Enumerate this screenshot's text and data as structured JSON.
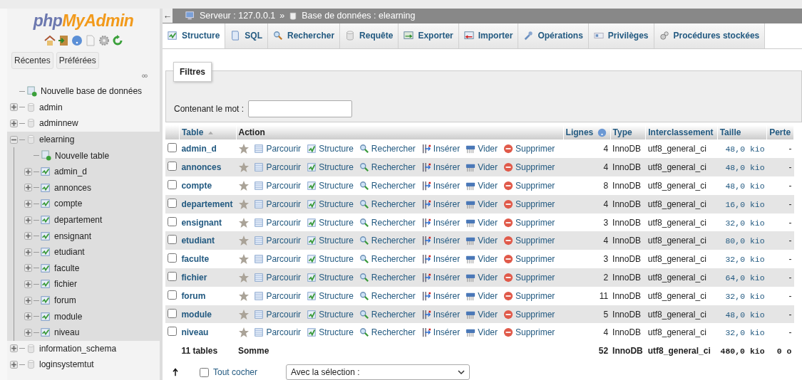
{
  "sidebar": {
    "logo_parts": [
      "php",
      "MyAdmin"
    ],
    "buttons": [
      "Récentes",
      "Préférées"
    ],
    "tree": [
      {
        "label": "Nouvelle base de données",
        "kind": "new",
        "selected": false
      },
      {
        "label": "admin",
        "kind": "database",
        "expanded": false,
        "selected": false
      },
      {
        "label": "adminnew",
        "kind": "database",
        "expanded": false,
        "selected": false
      },
      {
        "label": "elearning",
        "kind": "database",
        "expanded": true,
        "selected": true,
        "children": [
          {
            "label": "Nouvelle table",
            "kind": "new"
          },
          {
            "label": "admin_d",
            "kind": "table"
          },
          {
            "label": "annonces",
            "kind": "table"
          },
          {
            "label": "compte",
            "kind": "table"
          },
          {
            "label": "departement",
            "kind": "table"
          },
          {
            "label": "ensignant",
            "kind": "table"
          },
          {
            "label": "etudiant",
            "kind": "table"
          },
          {
            "label": "faculte",
            "kind": "table"
          },
          {
            "label": "fichier",
            "kind": "table"
          },
          {
            "label": "forum",
            "kind": "table"
          },
          {
            "label": "module",
            "kind": "table"
          },
          {
            "label": "niveau",
            "kind": "table"
          }
        ]
      },
      {
        "label": "information_schema",
        "kind": "database",
        "expanded": false,
        "selected": false
      },
      {
        "label": "loginsystemtut",
        "kind": "database",
        "expanded": false,
        "selected": false
      }
    ]
  },
  "breadcrumb": {
    "back": "←",
    "server": "Serveur : 127.0.0.1",
    "separator": "»",
    "database": "Base de données : elearning"
  },
  "tabs": [
    {
      "label": "Structure",
      "kind": "structure",
      "selected": true
    },
    {
      "label": "SQL",
      "kind": "sql",
      "selected": false
    },
    {
      "label": "Rechercher",
      "kind": "search",
      "selected": false
    },
    {
      "label": "Requête",
      "kind": "query",
      "selected": false
    },
    {
      "label": "Exporter",
      "kind": "export",
      "selected": false
    },
    {
      "label": "Importer",
      "kind": "import",
      "selected": false
    },
    {
      "label": "Opérations",
      "kind": "operations",
      "selected": false
    },
    {
      "label": "Privilèges",
      "kind": "privileges",
      "selected": false
    },
    {
      "label": "Procédures stockées",
      "kind": "procedures",
      "selected": false
    }
  ],
  "filter": {
    "legend": "Filtres",
    "label": "Contenant le mot :"
  },
  "table": {
    "columns": [
      {
        "label": "Table"
      },
      {
        "label": "Action"
      },
      {
        "label": "Lignes"
      },
      {
        "label": "Type"
      },
      {
        "label": "Interclassement"
      },
      {
        "label": "Taille"
      },
      {
        "label": "Perte"
      }
    ],
    "rows": [
      {
        "name": "admin_d",
        "checked": false,
        "favorite": false,
        "actions": [
          "Parcourir",
          "Structure",
          "Rechercher",
          "Insérer",
          "Vider",
          "Supprimer"
        ],
        "rows": "4",
        "type": "InnoDB",
        "collation": "utf8_general_ci",
        "size": "48,0 kio",
        "overhead": "-"
      },
      {
        "name": "annonces",
        "checked": false,
        "favorite": false,
        "actions": [
          "Parcourir",
          "Structure",
          "Rechercher",
          "Insérer",
          "Vider",
          "Supprimer"
        ],
        "rows": "4",
        "type": "InnoDB",
        "collation": "utf8_general_ci",
        "size": "48,0 kio",
        "overhead": "-"
      },
      {
        "name": "compte",
        "checked": false,
        "favorite": false,
        "actions": [
          "Parcourir",
          "Structure",
          "Rechercher",
          "Insérer",
          "Vider",
          "Supprimer"
        ],
        "rows": "8",
        "type": "InnoDB",
        "collation": "utf8_general_ci",
        "size": "48,0 kio",
        "overhead": "-"
      },
      {
        "name": "departement",
        "checked": false,
        "favorite": false,
        "actions": [
          "Parcourir",
          "Structure",
          "Rechercher",
          "Insérer",
          "Vider",
          "Supprimer"
        ],
        "rows": "4",
        "type": "InnoDB",
        "collation": "utf8_general_ci",
        "size": "16,0 kio",
        "overhead": "-"
      },
      {
        "name": "ensignant",
        "checked": false,
        "favorite": false,
        "actions": [
          "Parcourir",
          "Structure",
          "Rechercher",
          "Insérer",
          "Vider",
          "Supprimer"
        ],
        "rows": "3",
        "type": "InnoDB",
        "collation": "utf8_general_ci",
        "size": "32,0 kio",
        "overhead": "-"
      },
      {
        "name": "etudiant",
        "checked": false,
        "favorite": false,
        "actions": [
          "Parcourir",
          "Structure",
          "Rechercher",
          "Insérer",
          "Vider",
          "Supprimer"
        ],
        "rows": "4",
        "type": "InnoDB",
        "collation": "utf8_general_ci",
        "size": "80,0 kio",
        "overhead": "-"
      },
      {
        "name": "faculte",
        "checked": false,
        "favorite": false,
        "actions": [
          "Parcourir",
          "Structure",
          "Rechercher",
          "Insérer",
          "Vider",
          "Supprimer"
        ],
        "rows": "3",
        "type": "InnoDB",
        "collation": "utf8_general_ci",
        "size": "32,0 kio",
        "overhead": "-"
      },
      {
        "name": "fichier",
        "checked": false,
        "favorite": false,
        "actions": [
          "Parcourir",
          "Structure",
          "Rechercher",
          "Insérer",
          "Vider",
          "Supprimer"
        ],
        "rows": "2",
        "type": "InnoDB",
        "collation": "utf8_general_ci",
        "size": "64,0 kio",
        "overhead": "-"
      },
      {
        "name": "forum",
        "checked": false,
        "favorite": false,
        "actions": [
          "Parcourir",
          "Structure",
          "Rechercher",
          "Insérer",
          "Vider",
          "Supprimer"
        ],
        "rows": "11",
        "type": "InnoDB",
        "collation": "utf8_general_ci",
        "size": "32,0 kio",
        "overhead": "-"
      },
      {
        "name": "module",
        "checked": false,
        "favorite": false,
        "actions": [
          "Parcourir",
          "Structure",
          "Rechercher",
          "Insérer",
          "Vider",
          "Supprimer"
        ],
        "rows": "5",
        "type": "InnoDB",
        "collation": "utf8_general_ci",
        "size": "48,0 kio",
        "overhead": "-"
      },
      {
        "name": "niveau",
        "checked": false,
        "favorite": false,
        "actions": [
          "Parcourir",
          "Structure",
          "Rechercher",
          "Insérer",
          "Vider",
          "Supprimer"
        ],
        "rows": "4",
        "type": "InnoDB",
        "collation": "utf8_general_ci",
        "size": "32,0 kio",
        "overhead": "-"
      }
    ],
    "footer": {
      "count": "11 tables",
      "label": "Somme",
      "rows": "52",
      "type": "InnoDB",
      "collation": "utf8_general_ci",
      "size": "480,0 kio",
      "overhead": "0 o"
    }
  },
  "bulk": {
    "check_all": {
      "label": "Tout cocher",
      "checked": false
    },
    "with_selected": "Avec la sélection :"
  }
}
